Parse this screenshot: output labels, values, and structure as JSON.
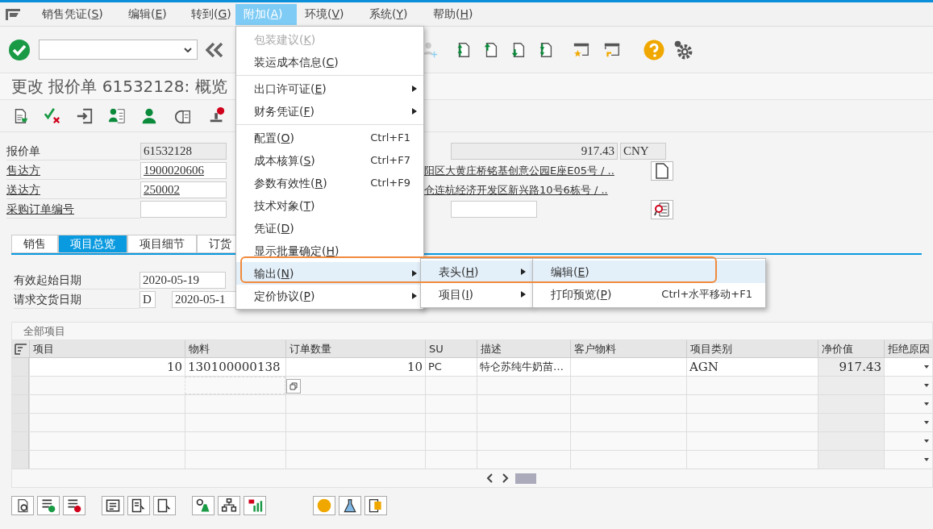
{
  "menu_bar": {
    "items": [
      {
        "label": "销售凭证(S)",
        "selected": false
      },
      {
        "label": "编辑(E)",
        "selected": false
      },
      {
        "label": "转到(G)",
        "selected": false
      },
      {
        "label": "附加(A)",
        "selected": true
      },
      {
        "label": "环境(V)",
        "selected": false
      },
      {
        "label": "系统(Y)",
        "selected": false
      },
      {
        "label": "帮助(H)",
        "selected": false
      }
    ]
  },
  "title": "更改 报价单 61532128: 概览",
  "header": {
    "rows": [
      {
        "label": "报价单",
        "link": false,
        "value": "61532128",
        "readonly": true
      },
      {
        "label": "售达方",
        "link": true,
        "value": "1900020606",
        "readonly": false
      },
      {
        "label": "送达方",
        "link": true,
        "value": "250002",
        "readonly": false
      },
      {
        "label": "采购订单编号",
        "link": true,
        "readonly": false
      }
    ],
    "net_value": "917.43",
    "currency": "CNY",
    "sold_to_address": "阳区大黄庄桥铭基创意公园E座E05号 / ..",
    "ship_to_address": "仓连杭经济开发区新兴路10号6栋号 / .."
  },
  "tabs": [
    {
      "label": "销售",
      "selected": false
    },
    {
      "label": "项目总览",
      "selected": true
    },
    {
      "label": "项目细节",
      "selected": false
    },
    {
      "label": "订货",
      "selected": false
    }
  ],
  "dates": {
    "valid_from_label": "有效起始日期",
    "valid_from": "2020-05-19",
    "delivery_label": "请求交货日期",
    "delivery_unit": "D",
    "delivery_date": "2020-05-1"
  },
  "table": {
    "title": "全部项目",
    "columns": [
      "项目",
      "物料",
      "订单数量",
      "SU",
      "描述",
      "客户物料",
      "项目类别",
      "净价值",
      "拒绝原因"
    ],
    "rows": [
      [
        "10",
        "130100000138",
        "10",
        "PC",
        "特仑苏纯牛奶苗…",
        "",
        "AGN",
        "917.43",
        ""
      ]
    ]
  },
  "dropdown": {
    "items": [
      {
        "kind": "item",
        "label": "包装建议(K)",
        "disabled": true,
        "selected": false,
        "submenu": false
      },
      {
        "kind": "item",
        "label": "装运成本信息(C)",
        "disabled": false,
        "selected": false,
        "submenu": false
      },
      {
        "kind": "separator"
      },
      {
        "kind": "item",
        "label": "出口许可证(E)",
        "disabled": false,
        "selected": false,
        "submenu": true
      },
      {
        "kind": "item",
        "label": "财务凭证(F)",
        "disabled": false,
        "selected": false,
        "submenu": true
      },
      {
        "kind": "separator"
      },
      {
        "kind": "item",
        "label": "配置(O)",
        "shortcut": "Ctrl+F1",
        "disabled": false,
        "selected": false,
        "submenu": false
      },
      {
        "kind": "item",
        "label": "成本核算(S)",
        "shortcut": "Ctrl+F7",
        "disabled": false,
        "selected": false,
        "submenu": false
      },
      {
        "kind": "item",
        "label": "参数有效性(R)",
        "shortcut": "Ctrl+F9",
        "disabled": false,
        "selected": false,
        "submenu": false
      },
      {
        "kind": "item",
        "label": "技术对象(T)",
        "disabled": false,
        "selected": false,
        "submenu": false
      },
      {
        "kind": "item",
        "label": "凭证(D)",
        "disabled": false,
        "selected": false,
        "submenu": false
      },
      {
        "kind": "item",
        "label": "显示批量确定(H)",
        "disabled": false,
        "selected": false,
        "submenu": false
      },
      {
        "kind": "item",
        "label": "输出(N)",
        "disabled": false,
        "selected": true,
        "submenu": true
      },
      {
        "kind": "item",
        "label": "定价协议(P)",
        "disabled": false,
        "selected": false,
        "submenu": true
      }
    ]
  },
  "submenu": {
    "items": [
      {
        "kind": "item",
        "label": "表头(H)",
        "disabled": false,
        "selected": true,
        "submenu": true
      },
      {
        "kind": "item",
        "label": "项目(I)",
        "disabled": false,
        "selected": false,
        "submenu": true
      }
    ]
  },
  "submenu2": {
    "items": [
      {
        "kind": "item",
        "label": "编辑(E)",
        "disabled": false,
        "selected": true,
        "submenu": false
      },
      {
        "kind": "item",
        "label": "打印预览(P)",
        "shortcut": "Ctrl+水平移动+F1",
        "disabled": false,
        "selected": false,
        "submenu": false
      }
    ]
  }
}
